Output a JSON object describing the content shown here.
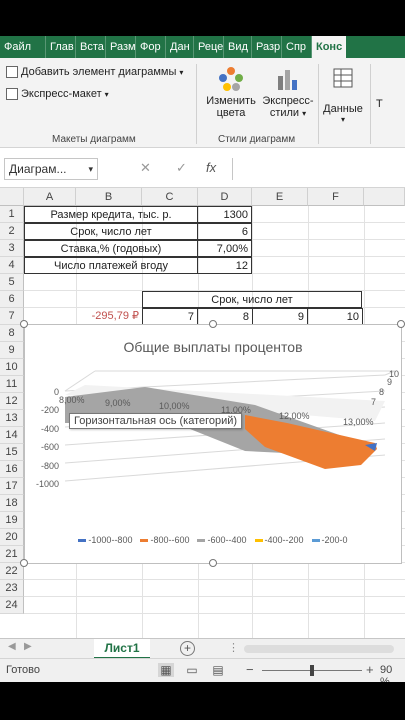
{
  "ribbon": {
    "tabs": [
      "Файл",
      "Глав",
      "Вста",
      "Разм",
      "Фор",
      "Дан",
      "Реце",
      "Вид",
      "Разр",
      "Спр",
      "Конс"
    ],
    "add_chart_element": "Добавить элемент диаграммы",
    "quick_layout": "Экспресс-макет",
    "group_layouts": "Макеты диаграмм",
    "change_colors_1": "Изменить",
    "change_colors_2": "цвета",
    "express_styles_1": "Экспресс-",
    "express_styles_2": "стили",
    "group_styles": "Стили диаграмм",
    "data_label": "Данные",
    "cut_label": "Т"
  },
  "formula_bar": {
    "name_box": "Диаграм...",
    "cancel": "✕",
    "enter": "✓",
    "fx": "fx"
  },
  "sheet": {
    "columns": [
      "A",
      "B",
      "C",
      "D",
      "E",
      "F"
    ],
    "rows": [
      "1",
      "2",
      "3",
      "4",
      "5",
      "6",
      "7",
      "8",
      "9",
      "10",
      "11",
      "12",
      "13",
      "14",
      "15",
      "16",
      "17",
      "18",
      "19",
      "20",
      "21",
      "22",
      "23",
      "24"
    ],
    "params": [
      {
        "label": "Размер кредита, тыс. р.",
        "value": "1300"
      },
      {
        "label": "Срок, число лет",
        "value": "6"
      },
      {
        "label": "Ставка,% (годовых)",
        "value": "7,00%"
      },
      {
        "label": "Число платежей вгоду",
        "value": "12"
      }
    ],
    "table_header": "Срок, число лет",
    "b7": "-295,79 ₽",
    "row7": [
      "7",
      "8",
      "9",
      "10"
    ]
  },
  "chart_data": {
    "type": "surface",
    "title": "Общие выплаты процентов",
    "y_ticks": [
      "0",
      "-200",
      "-400",
      "-600",
      "-800",
      "-1000"
    ],
    "x_ticks": [
      "8,00%",
      "9,00%",
      "10,00%",
      "11,00%",
      "12,00%",
      "13,00%"
    ],
    "z_ticks": [
      "10",
      "9",
      "8",
      "7"
    ],
    "ylim": [
      -1000,
      0
    ],
    "legend": [
      {
        "label": "-1000--800",
        "color": "#4472c4"
      },
      {
        "label": "-800--600",
        "color": "#ed7d31"
      },
      {
        "label": "-600--400",
        "color": "#a5a5a5"
      },
      {
        "label": "-400--200",
        "color": "#ffc000"
      },
      {
        "label": "-200-0",
        "color": "#5b9bd5"
      }
    ],
    "tooltip": "Горизонтальная ось (категорий)"
  },
  "sheet_tab": "Лист1",
  "add_sheet": "+",
  "status": {
    "ready": "Готово",
    "zoom": "90 %",
    "zoom_fraction": 0.9
  }
}
